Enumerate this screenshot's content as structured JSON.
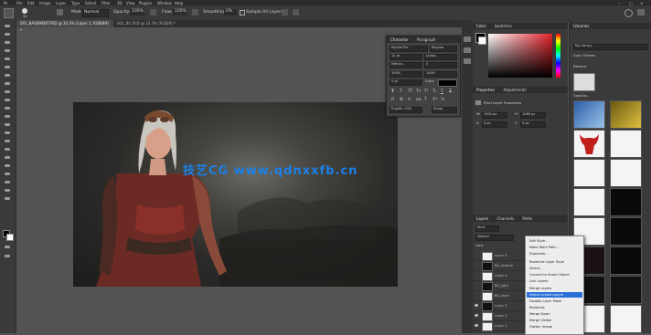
{
  "menubar": {
    "items": [
      "File",
      "Edit",
      "Image",
      "Layer",
      "Type",
      "Select",
      "Filter",
      "3D",
      "View",
      "Plugins",
      "Window",
      "Help"
    ]
  },
  "optionsbar": {
    "brush_size": "50",
    "mode_label": "Mode:",
    "mode_value": "Normal",
    "opacity_label": "Opacity:",
    "opacity_value": "100%",
    "flow_label": "Flow:",
    "flow_value": "100%",
    "smoothing_label": "Smoothing:",
    "smoothing_value": "0%",
    "sample_all": "Sample All Layers"
  },
  "tabs": [
    "001_BASEMENT.PSD @ 33.3% (Layer 1, RGB/8#) *",
    "002_BG.PSD @ 33.3% (RGB/8) *"
  ],
  "character_panel": {
    "tabs": [
      "Character",
      "Paragraph"
    ],
    "font": "Myriad Pro",
    "style": "Regular",
    "size": "12 pt",
    "leading": "(Auto)",
    "tracking": "0",
    "kerning": "Metrics",
    "vscale": "100%",
    "hscale": "100%",
    "baseline": "0 pt",
    "color_label": "Color:",
    "lang": "English: USA",
    "aa": "Sharp"
  },
  "color_panel": {
    "tabs": [
      "Color",
      "Swatches"
    ]
  },
  "properties_panel": {
    "tabs": [
      "Properties",
      "Adjustments"
    ],
    "title": "Pixel Layer Properties",
    "w_label": "W:",
    "w_value": "1920 px",
    "h_label": "H:",
    "h_value": "1080 px",
    "x_label": "X:",
    "x_value": "0 px",
    "y_label": "Y:",
    "y_value": "0 px"
  },
  "layers_panel": {
    "tabs": [
      "Layers",
      "Channels",
      "Paths"
    ],
    "kind": "Kind",
    "blend": "Normal",
    "lock_label": "Lock:",
    "layers": [
      "Layer 5",
      "BG_texture",
      "Layer 4",
      "BG_light",
      "BG_layer",
      "Layer 3",
      "Layer 2",
      "Layer 1"
    ]
  },
  "context_menu": {
    "items": [
      "Edit Style...",
      "Make Work Path...",
      "Duplicate...",
      "Rasterize Layer Style",
      "Select...",
      "Convert to Smart Object",
      "Link Layers",
      "Merge Layers",
      "Select Linked Layers",
      "Disable Layer Mask",
      "Rasterize",
      "Merge Down",
      "Merge Visible",
      "Flatten Image",
      "New 3D Layer"
    ],
    "highlighted_index": 8
  },
  "libraries_panel": {
    "title": "Libraries",
    "library_name": "My Library",
    "section_graphics": "Graphics",
    "section_colors": "Color Themes",
    "section_patterns": "Patterns"
  },
  "watermark": "技艺CG www.qdnxxfb.cn",
  "colors": {
    "accent": "#1a80e8",
    "panel_bg": "#3a3a3a",
    "workspace": "#535353"
  }
}
